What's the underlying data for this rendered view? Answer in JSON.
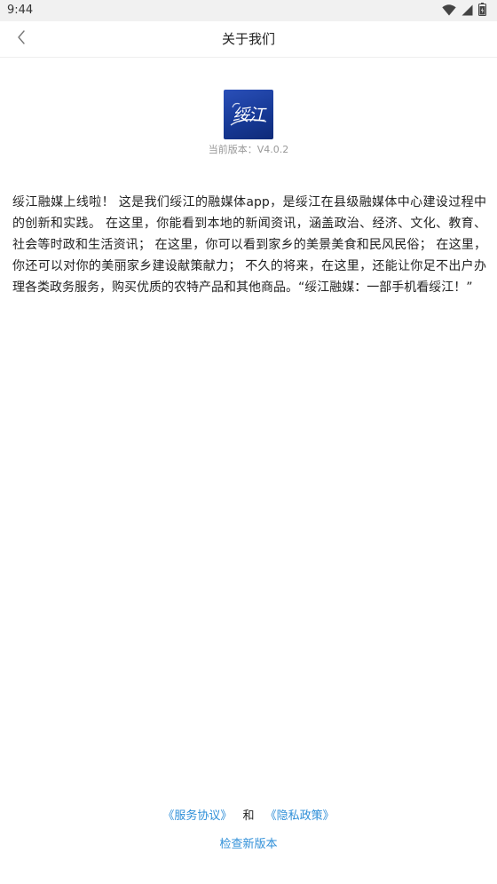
{
  "status_bar": {
    "time": "9:44",
    "icons": [
      "wifi-icon",
      "signal-icon",
      "battery-icon"
    ]
  },
  "nav": {
    "title": "关于我们",
    "back_icon": "chevron-left-icon"
  },
  "app": {
    "logo_text": "绥江",
    "version_label": "当前版本：V4.0.2"
  },
  "description": "绥江融媒上线啦！ 这是我们绥江的融媒体app，是绥江在县级融媒体中心建设过程中的创新和实践。 在这里，你能看到本地的新闻资讯，涵盖政治、经济、文化、教育、社会等时政和生活资讯； 在这里，你可以看到家乡的美景美食和民风民俗； 在这里，你还可以对你的美丽家乡建设献策献力； 不久的将来，在这里，还能让你足不出户办理各类政务服务，购买优质的农特产品和其他商品。“绥江融媒：一部手机看绥江！”",
  "footer": {
    "service_agreement": "《服务协议》",
    "and": "和",
    "privacy_policy": "《隐私政策》",
    "check_update": "检查新版本"
  },
  "colors": {
    "link": "#2f8fd8",
    "logo_bg": "#1f44a8",
    "status_bar_bg": "#f1f1f1"
  }
}
